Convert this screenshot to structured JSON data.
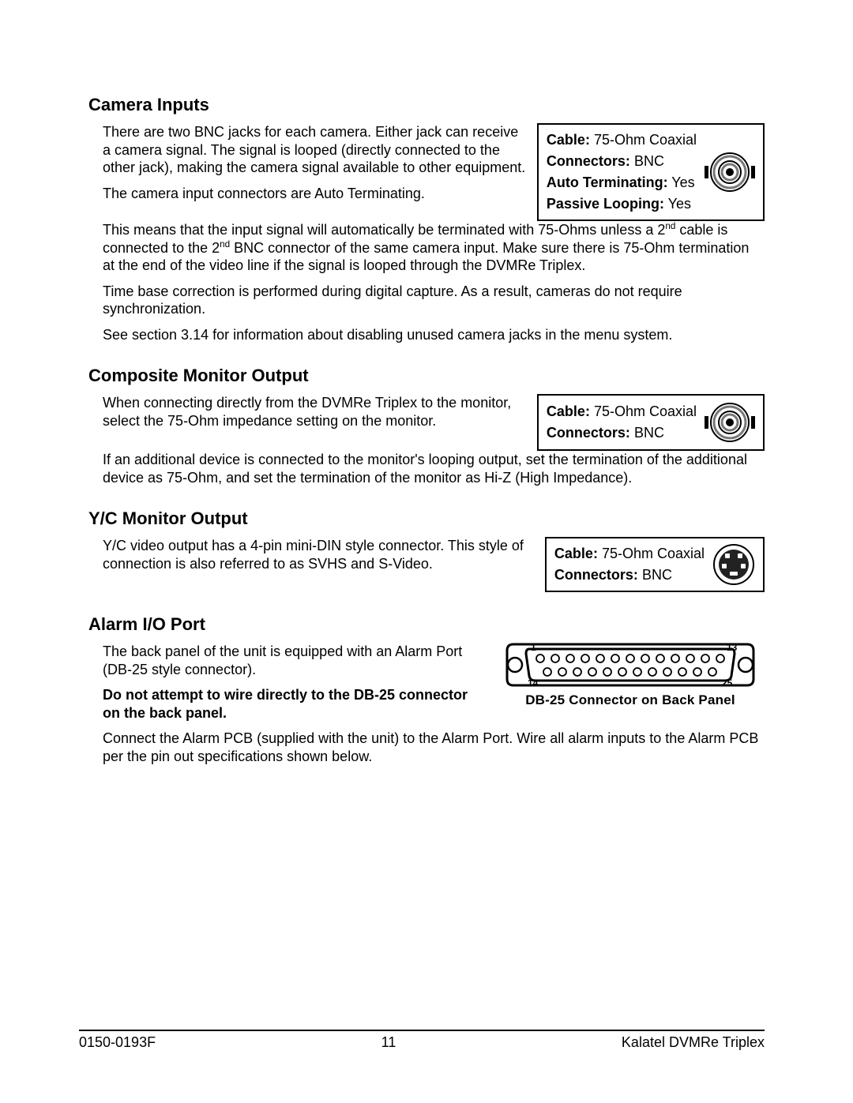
{
  "section1": {
    "heading": "Camera Inputs",
    "p1": "There are two BNC jacks for each camera.  Either jack can receive a camera signal.  The signal is looped (directly connected to the other jack), making the camera signal available to other equipment.",
    "p2": "The camera input connectors are Auto Terminating.",
    "spec": {
      "cable_label": "Cable:",
      "cable_value": "  75-Ohm Coaxial",
      "connectors_label": "Connectors:",
      "connectors_value": "  BNC",
      "auto_term_label": "Auto Terminating:",
      "auto_term_value": " Yes",
      "passive_label": "Passive Looping:",
      "passive_value": " Yes"
    },
    "p3a": "This means that the input signal will automatically be terminated with 75-Ohms unless a 2",
    "p3sup1": "nd",
    "p3b": " cable is connected to the 2",
    "p3sup2": "nd",
    "p3c": " BNC connector of the same camera input.  Make sure there is 75-Ohm termination at the end of the video line if the signal is looped through the DVMRe Triplex.",
    "p4": "Time base correction is performed during digital capture.  As a result, cameras do not require synchronization.",
    "p5": "See section 3.14 for information about disabling unused camera jacks in the menu system."
  },
  "section2": {
    "heading": "Composite Monitor Output",
    "p1": "When connecting directly from the DVMRe Triplex to the monitor, select the 75-Ohm impedance setting on the monitor.",
    "spec": {
      "cable_label": "Cable:",
      "cable_value": "  75-Ohm Coaxial",
      "connectors_label": "Connectors:",
      "connectors_value": "  BNC"
    },
    "p2": "If an additional device is connected to the monitor's looping output, set the termination of the additional device as 75-Ohm, and set the termination of the monitor as Hi-Z (High Impedance)."
  },
  "section3": {
    "heading": "Y/C Monitor Output",
    "p1": "Y/C video output has a 4-pin mini-DIN style connector.  This style of connection is also referred to as SVHS and S-Video.",
    "spec": {
      "cable_label": "Cable:",
      "cable_value": "  75-Ohm Coaxial",
      "connectors_label": "Connectors:",
      "connectors_value": "  BNC"
    }
  },
  "section4": {
    "heading": "Alarm I/O Port",
    "p1": "The back panel of the unit is equipped with an Alarm Port (DB-25 style connector).",
    "warn": "Do not attempt to wire directly to the DB-25 connector on the back panel.",
    "p2": "Connect the Alarm PCB (supplied with the unit) to the Alarm Port.  Wire all alarm inputs to the Alarm PCB per the pin out specifications shown below.",
    "db25": {
      "pin1": "1",
      "pin13": "13",
      "pin14": "14",
      "pin25": "25",
      "caption": "DB-25 Connector on Back Panel"
    }
  },
  "footer": {
    "left": "0150-0193F",
    "center": "11",
    "right": "Kalatel DVMRe Triplex"
  }
}
